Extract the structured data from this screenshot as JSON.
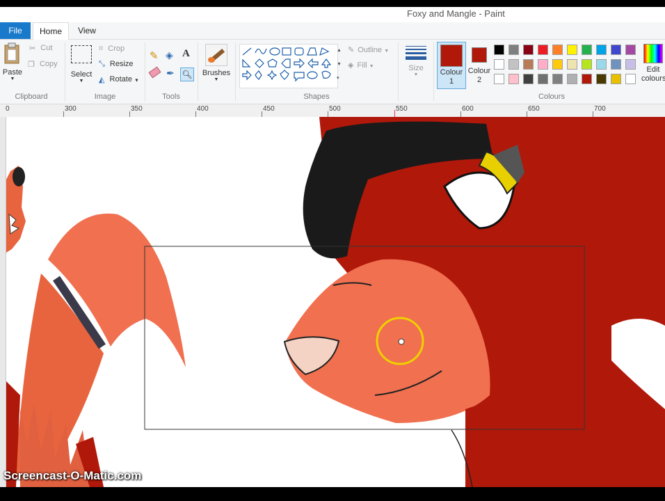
{
  "window": {
    "title": "Foxy and Mangle - Paint"
  },
  "tabs": [
    {
      "label": "File"
    },
    {
      "label": "Home"
    },
    {
      "label": "View"
    }
  ],
  "clipboard": {
    "paste": "Paste",
    "cut": "Cut",
    "copy": "Copy",
    "group": "Clipboard"
  },
  "image": {
    "select": "Select",
    "crop": "Crop",
    "resize": "Resize",
    "rotate": "Rotate",
    "group": "Image"
  },
  "tools": {
    "group": "Tools"
  },
  "brushes": {
    "label": "Brushes"
  },
  "shapes": {
    "outline": "Outline",
    "fill": "Fill",
    "group": "Shapes"
  },
  "size": {
    "label": "Size"
  },
  "colours": {
    "colour1_label": "Colour\n1",
    "colour2_label": "Colour\n2",
    "colour1": "#b0180a",
    "colour2": "#b0180a",
    "edit_label": "Edit\ncolours",
    "group": "Colours",
    "palette_row1": [
      "#000000",
      "#7f7f7f",
      "#880015",
      "#ed1c24",
      "#ff7f27",
      "#fff200",
      "#22b14c",
      "#00a2e8",
      "#3f48cc",
      "#a349a4"
    ],
    "palette_row2": [
      "#ffffff",
      "#c3c3c3",
      "#b97a57",
      "#ffaec9",
      "#ffc90e",
      "#efe4b0",
      "#b5e61d",
      "#99d9ea",
      "#7092be",
      "#c8bfe7"
    ],
    "palette_row3": [
      "#ffffff",
      "#ffc0cb",
      "#404040",
      "#707070",
      "#808080",
      "#b0b0b0",
      "#b0180a",
      "#4a3a00",
      "#e8c000",
      "#ffffff"
    ]
  },
  "ruler": {
    "ticks": [
      "300",
      "350",
      "400",
      "450",
      "500",
      "550",
      "600",
      "650",
      "700"
    ],
    "origin": "0"
  },
  "watermark": {
    "text": "Screencast-O-Matic.com"
  },
  "colors": {
    "paint_red": "#b0180a",
    "muzzle": "#f07050",
    "eye_yellow": "#e8d000"
  }
}
